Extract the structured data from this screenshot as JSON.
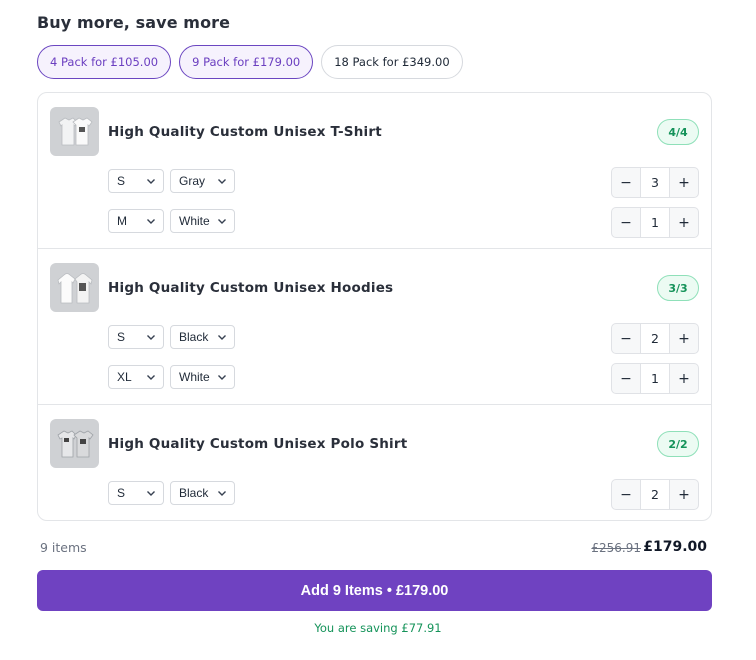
{
  "heading": "Buy more, save more",
  "packs": [
    {
      "label": "4 Pack for £105.00",
      "selected": true
    },
    {
      "label": "9 Pack for £179.00",
      "selected": true
    },
    {
      "label": "18 Pack for £349.00",
      "selected": false
    }
  ],
  "products": [
    {
      "title": "High Quality Custom Unisex T-Shirt",
      "badge": "4/4",
      "thumb_icon": "tshirt-icon",
      "variants": [
        {
          "size": "S",
          "color": "Gray",
          "qty": "3"
        },
        {
          "size": "M",
          "color": "White",
          "qty": "1"
        }
      ]
    },
    {
      "title": "High Quality Custom Unisex Hoodies",
      "badge": "3/3",
      "thumb_icon": "hoodie-icon",
      "variants": [
        {
          "size": "S",
          "color": "Black",
          "qty": "2"
        },
        {
          "size": "XL",
          "color": "White",
          "qty": "1"
        }
      ]
    },
    {
      "title": "High Quality Custom Unisex Polo Shirt",
      "badge": "2/2",
      "thumb_icon": "polo-shirt-icon",
      "variants": [
        {
          "size": "S",
          "color": "Black",
          "qty": "2"
        }
      ]
    }
  ],
  "stepper": {
    "minus": "−",
    "plus": "+"
  },
  "summary": {
    "items": "9 items",
    "price_old": "£256.91",
    "price_new": "£179.00"
  },
  "cta_label": "Add 9 Items • £179.00",
  "saving": "You are saving £77.91",
  "colors": {
    "accent": "#6f42c1",
    "success": "#15935a"
  }
}
